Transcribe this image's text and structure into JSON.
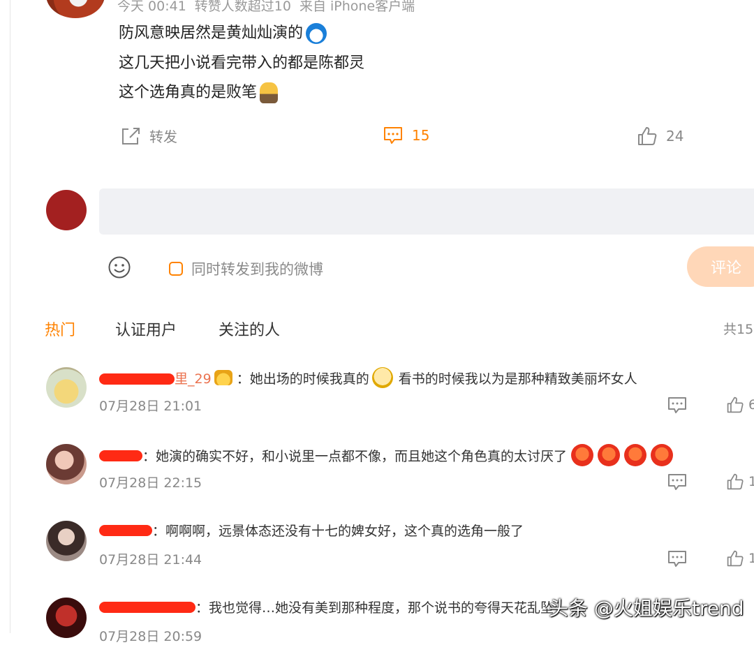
{
  "post": {
    "meta": {
      "time": "今天 00:41",
      "likes_note": "转赞人数超过10",
      "source": "来自 iPhone客户端"
    },
    "lines": [
      "防风意映居然是黄灿灿演的",
      "这几天把小说看完带入的都是陈都灵",
      "这个选角真的是败笔"
    ],
    "actions": {
      "repost_label": "转发",
      "comment_count": "15",
      "like_count": "24"
    }
  },
  "composer": {
    "placeholder": "",
    "repost_checkbox_label": "同时转发到我的微博",
    "submit_label": "评论"
  },
  "tabs": {
    "hot": "热门",
    "verified": "认证用户",
    "following": "关注的人",
    "total": "共15"
  },
  "comments": [
    {
      "name_tail": "里_29",
      "text_a": "：她出场的时候我真的",
      "text_b": "看书的时候我以为是那种精致美丽坏女人",
      "time": "07月28日 21:01",
      "like": "6"
    },
    {
      "name_tail": "",
      "text_a": "：她演的确实不好，和小说里一点都不像，而且她这个角色真的太讨厌了",
      "text_b": "",
      "time": "07月28日 22:15",
      "like": "1"
    },
    {
      "name_tail": "",
      "text_a": "：啊啊啊，远景体态还没有十七的婢女好，这个真的选角一般了",
      "text_b": "",
      "time": "07月28日 21:44",
      "like": "1"
    },
    {
      "name_tail": "",
      "text_a": "：我也觉得…她没有美到那种程度，那个说书的夸得天花乱坠",
      "text_b": "",
      "time": "07月28日 20:59",
      "like": ""
    }
  ],
  "watermark": "头条 @火姐娱乐trend",
  "colors": {
    "accent": "#ff8200",
    "name": "#eb7350",
    "redact": "#ff2a14"
  }
}
